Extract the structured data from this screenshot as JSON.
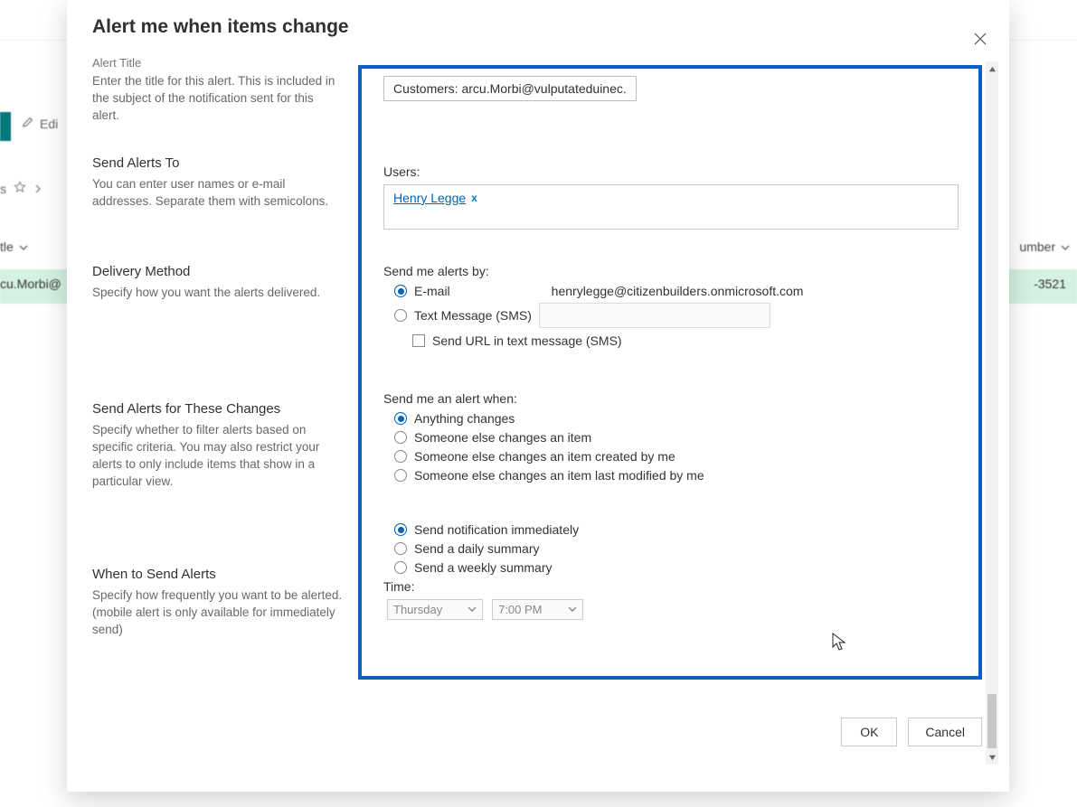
{
  "bg": {
    "edit": "Edi",
    "star_prefix": "s",
    "title_col": "tle",
    "number_col": "umber",
    "row_left": "cu.Morbi@",
    "row_right": "-3521"
  },
  "dialog": {
    "title": "Alert me when items change",
    "close_tooltip": "Close",
    "ok": "OK",
    "cancel": "Cancel"
  },
  "left": {
    "alert_title_head": "Alert Title",
    "alert_title_desc": "Enter the title for this alert. This is included in the subject of the notification sent for this alert.",
    "send_to_head": "Send Alerts To",
    "send_to_desc": "You can enter user names or e-mail addresses. Separate them with semicolons.",
    "delivery_head": "Delivery Method",
    "delivery_desc": "Specify how you want the alerts delivered.",
    "changes_head": "Send Alerts for These Changes",
    "changes_desc": "Specify whether to filter alerts based on specific criteria. You may also restrict your alerts to only include items that show in a particular view.",
    "when_head": "When to Send Alerts",
    "when_desc": "Specify how frequently you want to be alerted. (mobile alert is only available for immediately send)"
  },
  "form": {
    "alert_title_value": "Customers: arcu.Morbi@vulputateduinec.",
    "users_label": "Users:",
    "users_chip_name": "Henry Legge",
    "users_chip_x": "x",
    "send_by_label": "Send me alerts by:",
    "send_by_email": "E-mail",
    "send_by_email_addr": "henrylegge@citizenbuilders.onmicrosoft.com",
    "send_by_sms": "Text Message (SMS)",
    "send_url_sms": "Send URL in text message (SMS)",
    "alert_when_label": "Send me an alert when:",
    "alert_when_opts": [
      "Anything changes",
      "Someone else changes an item",
      "Someone else changes an item created by me",
      "Someone else changes an item last modified by me"
    ],
    "when_send_opts": [
      "Send notification immediately",
      "Send a daily summary",
      "Send a weekly summary"
    ],
    "time_label": "Time:",
    "time_day": "Thursday",
    "time_hour": "7:00 PM"
  }
}
